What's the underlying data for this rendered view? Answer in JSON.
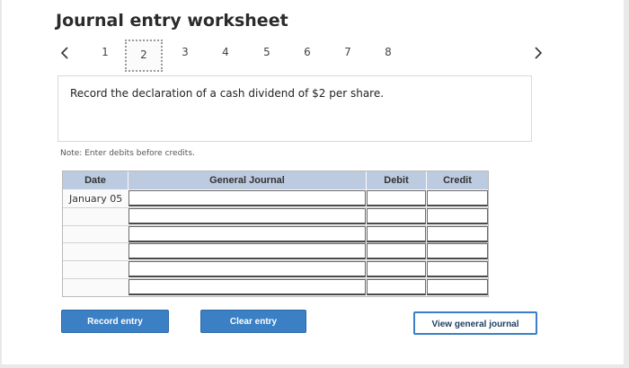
{
  "header": {
    "title": "Journal entry worksheet"
  },
  "steps": [
    "1",
    "2",
    "3",
    "4",
    "5",
    "6",
    "7",
    "8"
  ],
  "current_step": "2",
  "prompt": {
    "text": "Record the declaration of a cash dividend of $2 per share."
  },
  "note": "Note: Enter debits before credits.",
  "table": {
    "headers": {
      "date": "Date",
      "journal": "General Journal",
      "debit": "Debit",
      "credit": "Credit"
    },
    "rows": [
      {
        "date": "January 05"
      },
      {
        "date": ""
      },
      {
        "date": ""
      },
      {
        "date": ""
      },
      {
        "date": ""
      },
      {
        "date": ""
      }
    ]
  },
  "buttons": {
    "record": "Record entry",
    "clear": "Clear entry",
    "view": "View general journal"
  },
  "colors": {
    "header_bg": "#bccbe0",
    "button_blue": "#3b7fc4"
  }
}
